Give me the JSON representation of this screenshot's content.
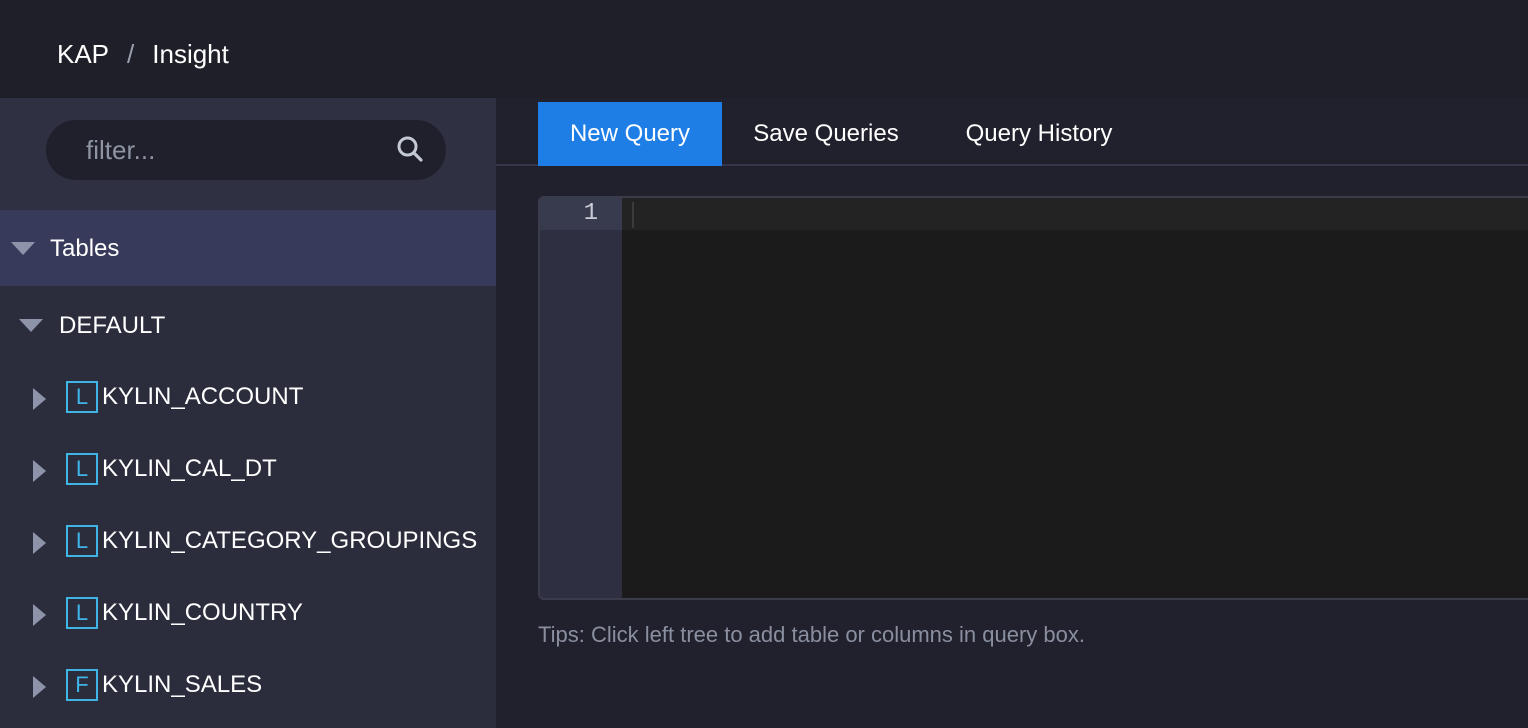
{
  "breadcrumb": {
    "root": "KAP",
    "separator": "/",
    "current": "Insight"
  },
  "sidebar": {
    "filter": {
      "placeholder": "filter...",
      "value": "",
      "icon": "search-icon"
    },
    "tables_header": "Tables",
    "database": "DEFAULT",
    "tables": [
      {
        "badge": "L",
        "name": "KYLIN_ACCOUNT"
      },
      {
        "badge": "L",
        "name": "KYLIN_CAL_DT"
      },
      {
        "badge": "L",
        "name": "KYLIN_CATEGORY_GROUPINGS"
      },
      {
        "badge": "L",
        "name": "KYLIN_COUNTRY"
      },
      {
        "badge": "F",
        "name": "KYLIN_SALES"
      }
    ]
  },
  "main": {
    "tabs": [
      {
        "label": "New Query",
        "active": true
      },
      {
        "label": "Save Queries",
        "active": false
      },
      {
        "label": "Query History",
        "active": false
      }
    ],
    "editor": {
      "line_number": "1",
      "content": ""
    },
    "tips": "Tips: Click left tree to add table or columns in query box."
  },
  "colors": {
    "accent": "#1f7de6",
    "badge": "#3fb4e6",
    "sidebar_selected": "#373a5a",
    "background": "#21212d"
  }
}
